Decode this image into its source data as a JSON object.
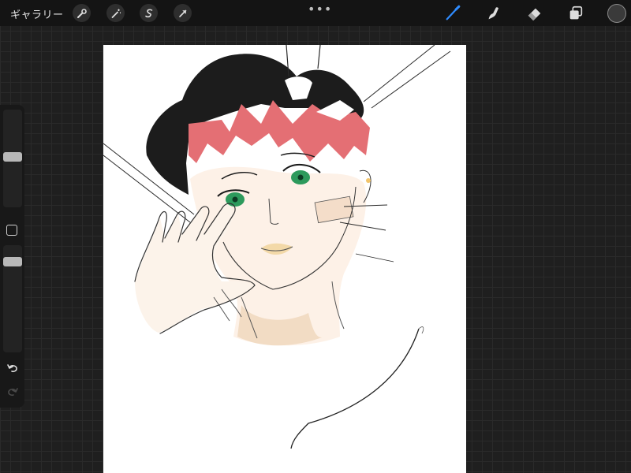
{
  "topbar": {
    "gallery_label": "ギャラリー",
    "left_tools": [
      {
        "name": "actions",
        "icon": "wrench-icon"
      },
      {
        "name": "adjustments",
        "icon": "magic-wand-icon"
      },
      {
        "name": "selection",
        "icon": "selection-s-icon"
      },
      {
        "name": "transform",
        "icon": "arrow-cursor-icon"
      }
    ],
    "more_label": "•••",
    "right_tools": [
      {
        "name": "brush",
        "icon": "brush-icon",
        "active": true
      },
      {
        "name": "smudge",
        "icon": "smudge-icon",
        "active": false
      },
      {
        "name": "eraser",
        "icon": "eraser-icon",
        "active": false
      },
      {
        "name": "layers",
        "icon": "layers-icon",
        "active": false
      }
    ],
    "current_color": "#3a3a3a"
  },
  "sidebar": {
    "brush_size_level": 0.52,
    "opacity_level": 0.88,
    "undo_icon": "undo-icon",
    "redo_icon": "redo-icon"
  },
  "colors": {
    "accent": "#2f8cff",
    "hair": "#1c1c1c",
    "headband": "#e46f74",
    "skin": "#fdf1e7",
    "eye": "#2d9a5c",
    "lips": "#f3d9a8"
  }
}
